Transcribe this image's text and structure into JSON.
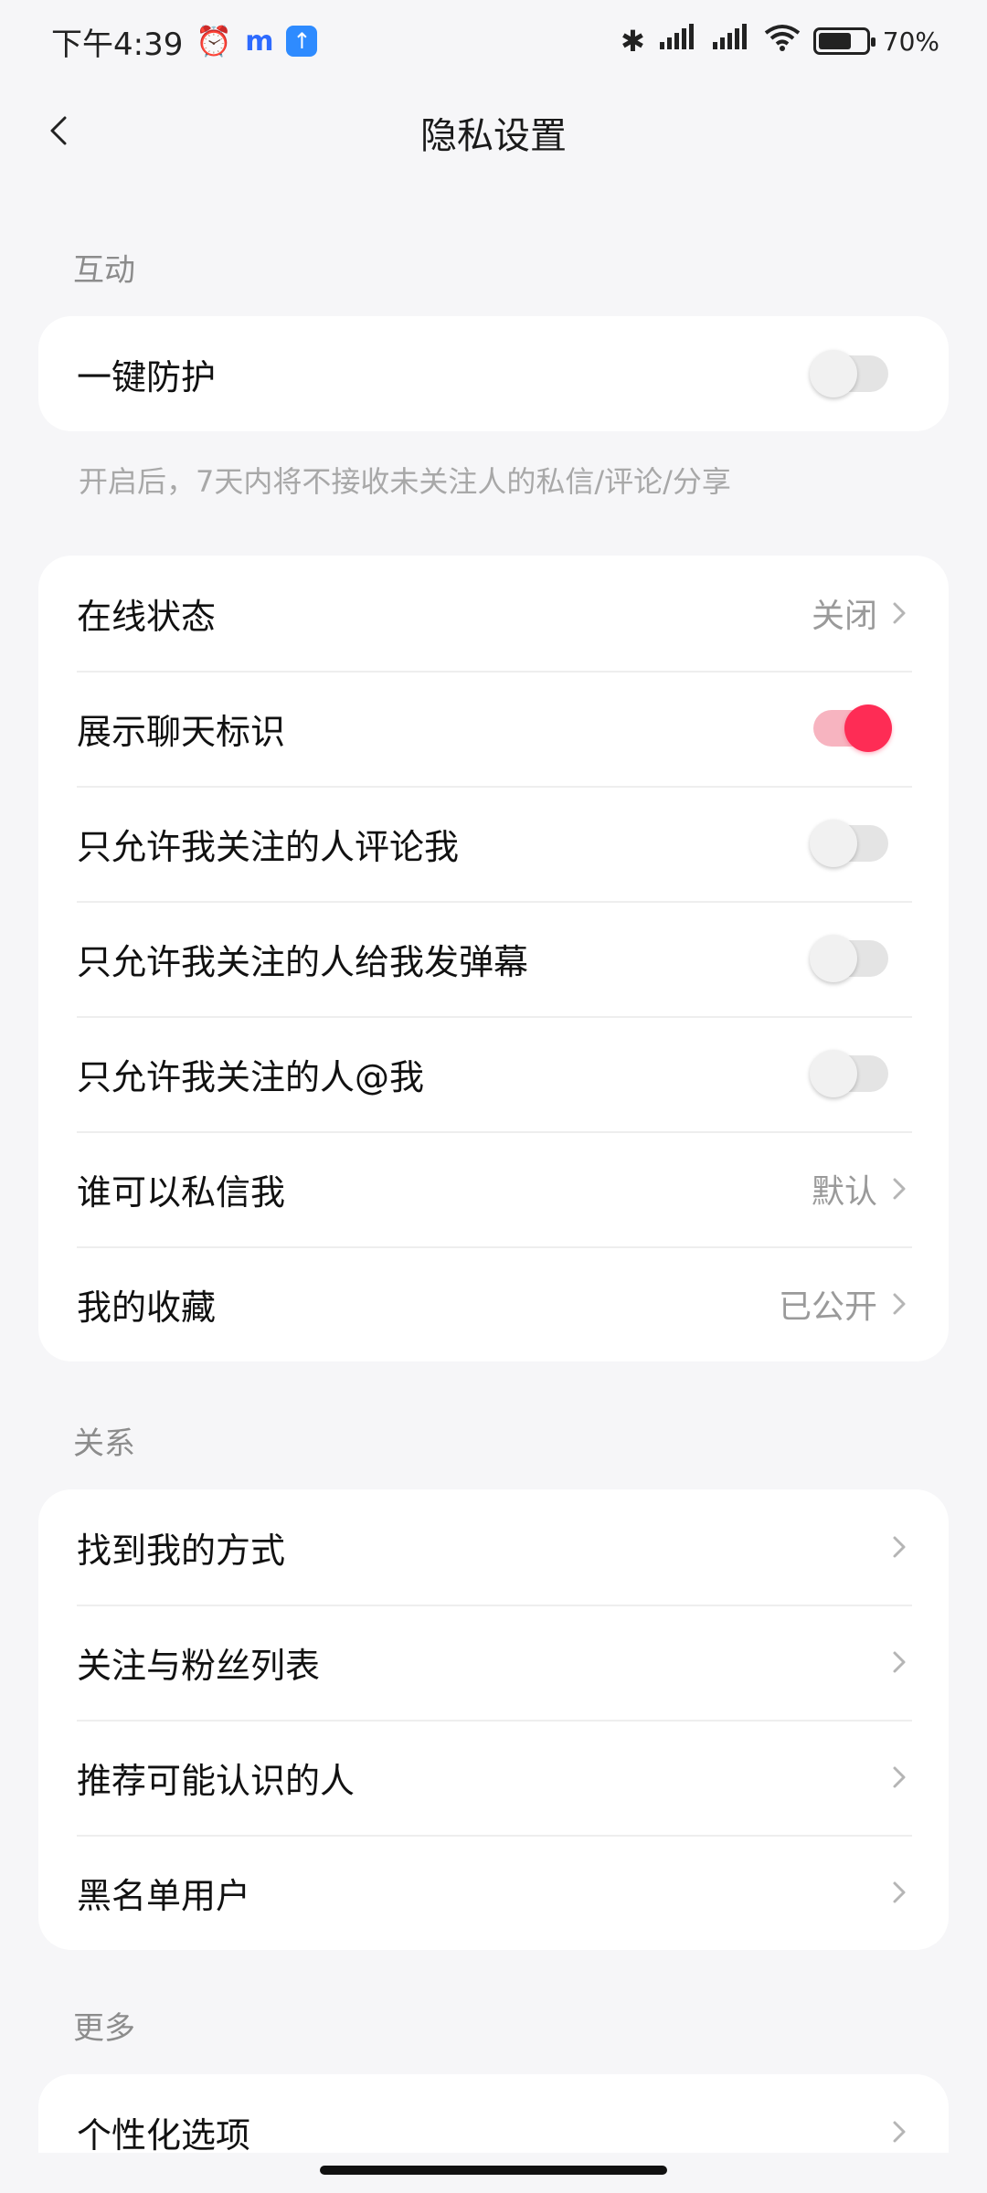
{
  "status_bar": {
    "time": "下午4:39",
    "battery": "70%",
    "battery_level": 0.7,
    "icons": [
      "alarm-icon",
      "m-app-icon",
      "upload-app-icon",
      "bluetooth-icon",
      "hd-signal-icon",
      "hd-signal-icon",
      "wifi-icon",
      "battery-icon"
    ]
  },
  "header": {
    "title": "隐私设置",
    "back_icon": "chevron-left-icon"
  },
  "sections": {
    "interaction": {
      "label": "互动",
      "one_key": {
        "label": "一键防护",
        "enabled": false
      },
      "hint": "开启后，7天内将不接收未关注人的私信/评论/分享",
      "online_status": {
        "label": "在线状态",
        "value": "关闭"
      },
      "chat_badge": {
        "label": "展示聊天标识",
        "enabled": true
      },
      "comment_only_following": {
        "label": "只允许我关注的人评论我",
        "enabled": false
      },
      "danmaku_only_following": {
        "label": "只允许我关注的人给我发弹幕",
        "enabled": false
      },
      "mention_only_following": {
        "label": "只允许我关注的人@我",
        "enabled": false
      },
      "who_can_dm": {
        "label": "谁可以私信我",
        "value": "默认"
      },
      "my_favorites": {
        "label": "我的收藏",
        "value": "已公开"
      }
    },
    "relations": {
      "label": "关系",
      "items": [
        {
          "label": "找到我的方式"
        },
        {
          "label": "关注与粉丝列表"
        },
        {
          "label": "推荐可能认识的人"
        },
        {
          "label": "黑名单用户"
        }
      ]
    },
    "more": {
      "label": "更多",
      "items": [
        {
          "label": "个性化选项"
        }
      ]
    }
  },
  "colors": {
    "accent": "#fe2c55",
    "background": "#f6f6f8",
    "secondary_text": "#9a9a9a"
  }
}
